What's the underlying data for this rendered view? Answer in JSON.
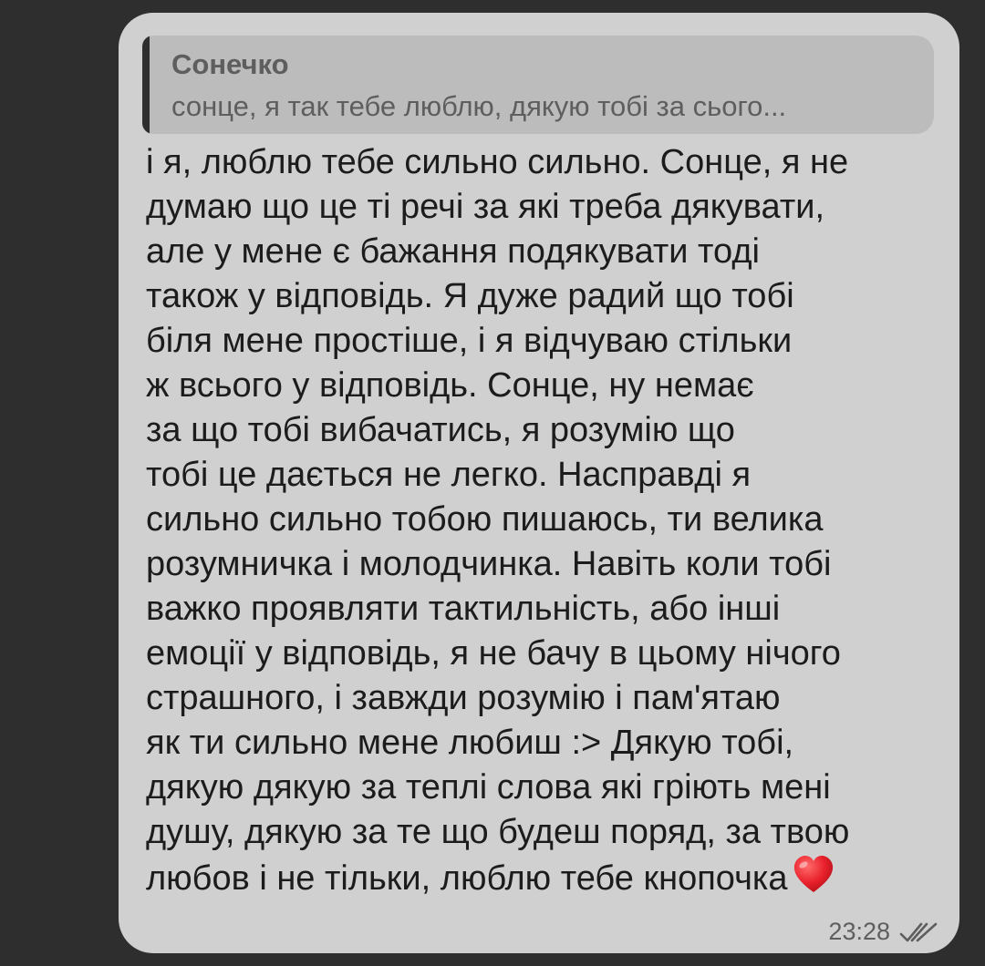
{
  "reply": {
    "author": "Сонечко",
    "text": "сонце, я так тебе люблю, дякую тобі за сього..."
  },
  "message": {
    "lines": [
      "і я, люблю тебе сильно сильно. Сонце, я не",
      "думаю що це ті речі за які треба дякувати,",
      "але у мене є бажання подякувати тоді",
      "також у відповідь. Я дуже радий що тобі",
      "біля мене простіше, і я відчуваю стільки",
      "ж всього у відповідь. Сонце, ну немає",
      "за що тобі вибачатись, я розумію що",
      "тобі це дається не легко. Насправді я",
      "сильно сильно тобою пишаюсь, ти велика",
      "розумничка і молодчинка. Навіть коли тобі",
      "важко проявляти тактильність, або інші",
      "емоції у відповідь, я не бачу в цьому нічого",
      "страшного, і завжди розумію і пам'ятаю",
      "як ти сильно мене любиш :> Дякую тобі,",
      "дякую дякую за теплі слова які гріють мені",
      "душу, дякую за те що будеш поряд, за твою",
      "любов і не тільки, люблю тебе кнопочка"
    ],
    "emoji": "red-heart-icon"
  },
  "meta": {
    "time": "23:28",
    "status_icon": "double-check-icon"
  },
  "colors": {
    "background": "#2e2e2e",
    "bubble": "#d0d0d0",
    "reply_box": "#bcbcbc",
    "reply_bar": "#2e2e2e",
    "text": "#1c1c1c",
    "muted_text": "#5e5e5e",
    "heart": "#e8202b"
  }
}
